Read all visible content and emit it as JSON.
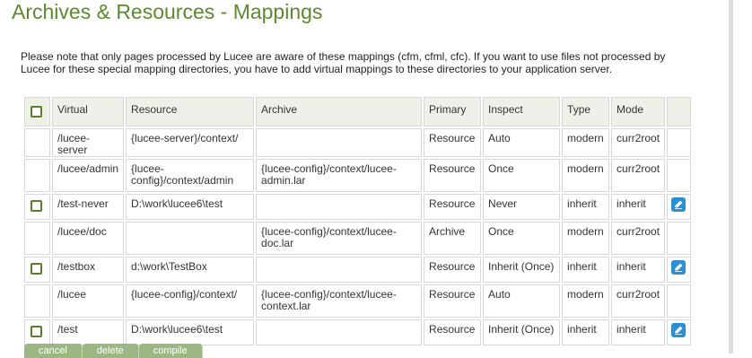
{
  "page": {
    "title": "Archives & Resources - Mappings",
    "note": "Please note that only pages processed by Lucee are aware of these mappings (cfm, cfml, cfc). If you want to use files not processed by Lucee for these special mapping directories, you have to add virtual mappings to these directories to your application server."
  },
  "table": {
    "headers": {
      "virtual": "Virtual",
      "resource": "Resource",
      "archive": "Archive",
      "primary": "Primary",
      "inspect": "Inspect",
      "type": "Type",
      "mode": "Mode"
    },
    "rows": [
      {
        "virtual": "/lucee-server",
        "resource": "{lucee-server}/context/",
        "archive": "",
        "primary": "Resource",
        "inspect": "Auto",
        "type": "modern",
        "mode": "curr2root"
      },
      {
        "virtual": "/lucee/admin",
        "resource": "{lucee-config}/context/admin",
        "archive": "{lucee-config}/context/lucee-admin.lar",
        "primary": "Resource",
        "inspect": "Once",
        "type": "modern",
        "mode": "curr2root"
      },
      {
        "virtual": "/test-never",
        "resource": "D:\\work\\lucee6\\test",
        "archive": "",
        "primary": "Resource",
        "inspect": "Never",
        "type": "inherit",
        "mode": "inherit"
      },
      {
        "virtual": "/lucee/doc",
        "resource": "",
        "archive": "{lucee-config}/context/lucee-doc.lar",
        "primary": "Archive",
        "inspect": "Once",
        "type": "modern",
        "mode": "curr2root"
      },
      {
        "virtual": "/testbox",
        "resource": "d:\\work\\TestBox",
        "archive": "",
        "primary": "Resource",
        "inspect": "Inherit (Once)",
        "type": "inherit",
        "mode": "inherit"
      },
      {
        "virtual": "/lucee",
        "resource": "{lucee-config}/context/",
        "archive": "{lucee-config}/context/lucee-context.lar",
        "primary": "Resource",
        "inspect": "Auto",
        "type": "modern",
        "mode": "curr2root"
      },
      {
        "virtual": "/test",
        "resource": "D:\\work\\lucee6\\test",
        "archive": "",
        "primary": "Resource",
        "inspect": "Inherit (Once)",
        "type": "inherit",
        "mode": "inherit"
      }
    ]
  },
  "buttons": {
    "cancel": "cancel",
    "delete": "delete",
    "compile": "compile"
  },
  "icons": {
    "select_all": "checkbox-icon",
    "edit": "pencil-icon"
  },
  "colors": {
    "title": "#5b8a2e",
    "checkbox_border": "#5b7d2e",
    "edit_button": "#2b8fd6",
    "header_bg": "#eef1e8",
    "button_bg": "#9bb883"
  }
}
